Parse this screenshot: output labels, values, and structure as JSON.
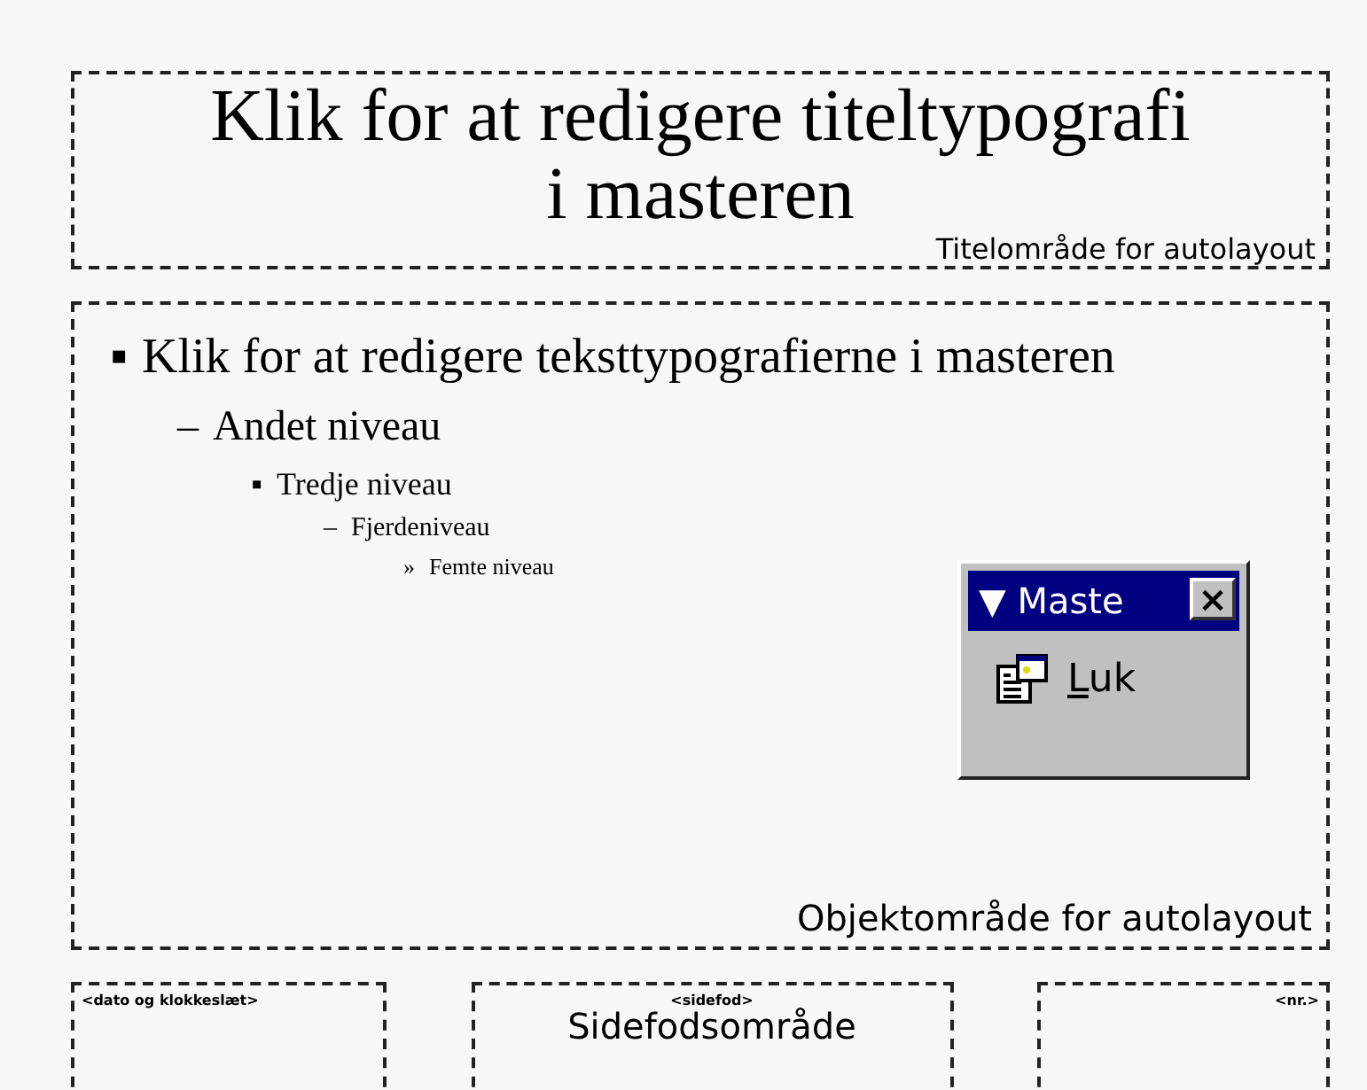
{
  "title_placeholder": {
    "text": "Klik for at redigere titeltypografi i masteren",
    "area_label": "Titelområde for autolayout"
  },
  "body_placeholder": {
    "area_label": "Objektområde for autolayout",
    "levels": [
      {
        "bullet": "▪",
        "text": "Klik for at redigere teksttypografierne i masteren"
      },
      {
        "bullet": "–",
        "text": "Andet niveau"
      },
      {
        "bullet": "▪",
        "text": "Tredje niveau"
      },
      {
        "bullet": "–",
        "text": "Fjerdeniveau"
      },
      {
        "bullet": "»",
        "text": "Femte niveau"
      }
    ]
  },
  "footer": {
    "date": {
      "field": "<dato og klokkeslæt>"
    },
    "footer": {
      "field": "<sidefod>",
      "area_label": "Sidefodsområde"
    },
    "number": {
      "field": "<nr.>"
    }
  },
  "master_toolbar": {
    "title": "▼ Maste",
    "close": "×",
    "button": {
      "label": "Luk"
    }
  }
}
